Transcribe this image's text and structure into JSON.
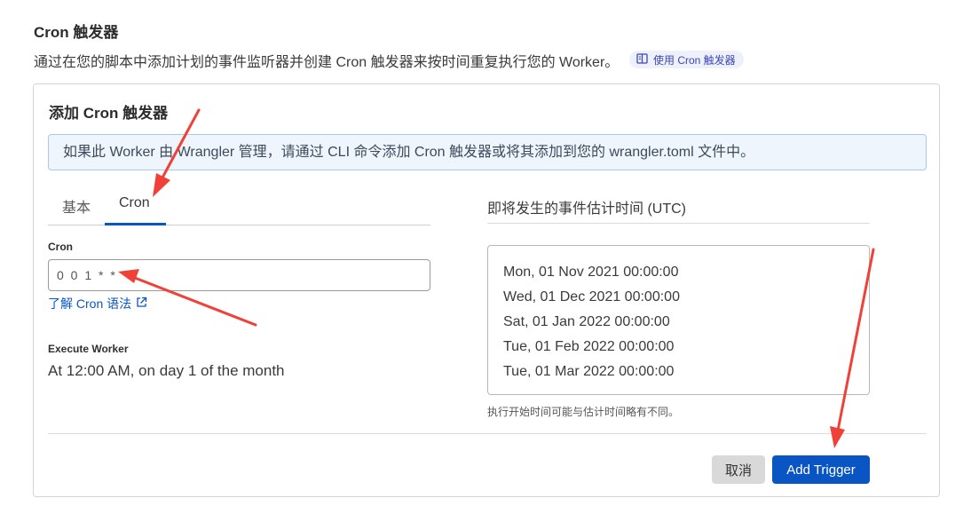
{
  "header": {
    "title": "Cron 触发器",
    "description": "通过在您的脚本中添加计划的事件监听器并创建 Cron 触发器来按时间重复执行您的 Worker。",
    "doc_link": "使用 Cron 触发器",
    "doc_link_icon": "book-icon"
  },
  "card": {
    "title": "添加 Cron 触发器",
    "notice": "如果此 Worker 由 Wrangler 管理，请通过 CLI 命令添加 Cron 触发器或将其添加到您的 wrangler.toml 文件中。",
    "tabs": [
      {
        "label": "基本",
        "active": false
      },
      {
        "label": "Cron",
        "active": true
      }
    ],
    "cron_label": "Cron",
    "cron_value": "0 0 1 * *",
    "learn_link": "了解 Cron 语法",
    "learn_link_icon": "external-link-icon",
    "execute_label": "Execute Worker",
    "execute_value": "At 12:00 AM, on day 1 of the month",
    "upcoming_title": "即将发生的事件估计时间 (UTC)",
    "upcoming_dates": [
      "Mon, 01 Nov 2021 00:00:00",
      "Wed, 01 Dec 2021 00:00:00",
      "Sat, 01 Jan 2022 00:00:00",
      "Tue, 01 Feb 2022 00:00:00",
      "Tue, 01 Mar 2022 00:00:00"
    ],
    "hint": "执行开始时间可能与估计时间略有不同。",
    "cancel_label": "取消",
    "submit_label": "Add Trigger"
  },
  "colors": {
    "accent": "#0a55c4",
    "notice_bg": "#eef5fd",
    "annotation_arrow": "#ef4138"
  }
}
